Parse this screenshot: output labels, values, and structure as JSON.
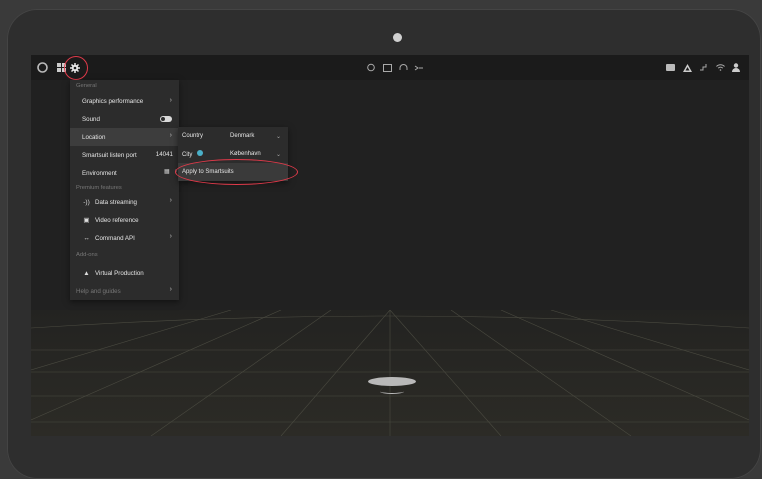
{
  "menu": {
    "section_general": "General",
    "items": [
      {
        "label": "Graphics performance"
      },
      {
        "label": "Sound"
      },
      {
        "label": "Location"
      },
      {
        "label": "Smartsuit listen port",
        "value": "14041"
      },
      {
        "label": "Environment"
      }
    ],
    "section_premium": "Premium features",
    "premium": [
      {
        "label": "Data streaming",
        "icon": "stream-icon"
      },
      {
        "label": "Video reference",
        "icon": "video-icon"
      },
      {
        "label": "Command API",
        "icon": "api-icon"
      }
    ],
    "section_addons": "Add-ons",
    "addons": [
      {
        "label": "Virtual Production",
        "icon": "triangle-icon"
      }
    ],
    "help": "Help and guides"
  },
  "location": {
    "country_label": "Country",
    "country_value": "Denmark",
    "city_label": "City",
    "city_value": "København",
    "apply_label": "Apply to Smartsuits"
  },
  "colors": {
    "highlight": "#e03a4a"
  }
}
